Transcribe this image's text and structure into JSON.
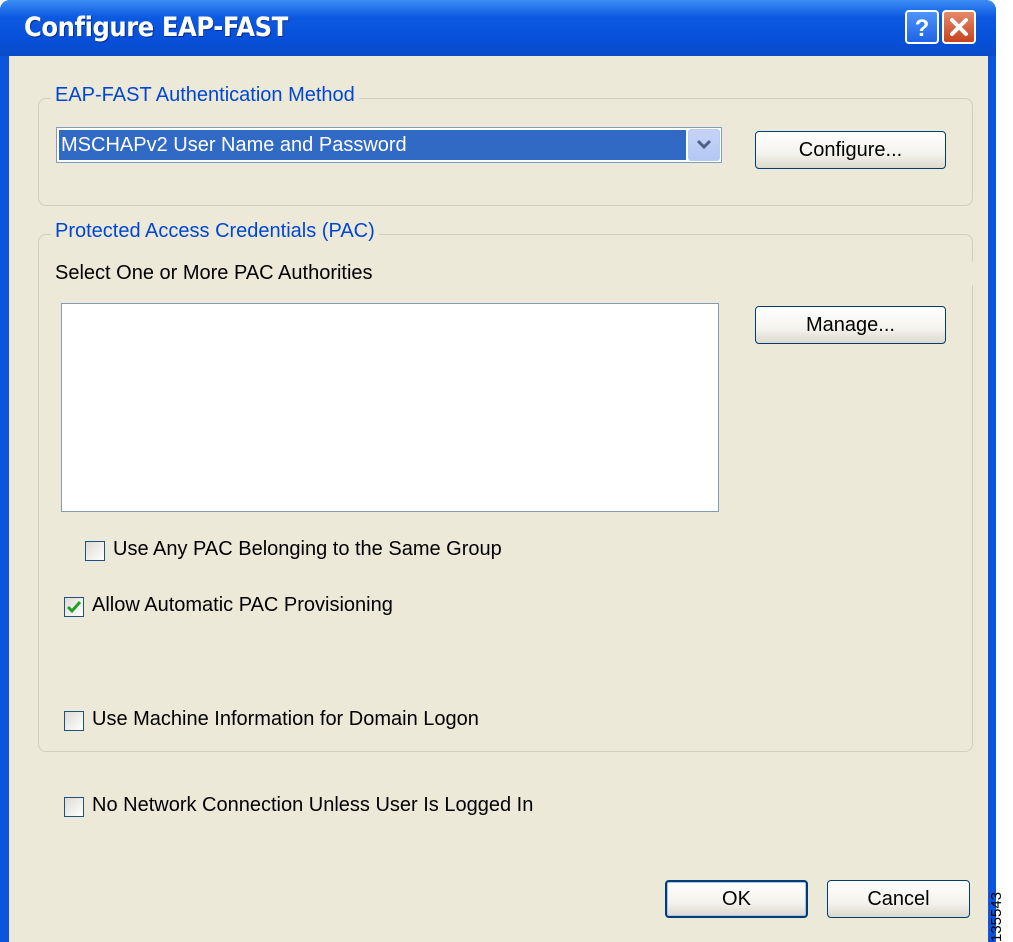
{
  "window": {
    "title": "Configure EAP-FAST"
  },
  "titlebar": {
    "help_icon": "question-mark-icon",
    "close_icon": "close-x-icon"
  },
  "auth_method": {
    "legend": "EAP-FAST Authentication Method",
    "selected": "MSCHAPv2 User Name and Password",
    "configure_label": "Configure..."
  },
  "pac": {
    "legend": "Protected Access Credentials (PAC)",
    "select_label": "Select One or More PAC Authorities",
    "manage_label": "Manage...",
    "authorities": [],
    "use_any_pac": {
      "label": "Use Any PAC Belonging to the Same Group",
      "checked": false
    },
    "allow_auto": {
      "label": "Allow Automatic PAC Provisioning",
      "checked": true
    },
    "use_machine": {
      "label": "Use Machine Information for Domain Logon",
      "checked": false
    }
  },
  "no_network": {
    "label": "No Network Connection Unless User Is Logged In",
    "checked": false
  },
  "footer": {
    "ok_label": "OK",
    "cancel_label": "Cancel"
  },
  "figure_id": "135543",
  "colors": {
    "titlebar": "#0a54e0",
    "dialog_bg": "#ece9d8",
    "legend_text": "#0046d5",
    "selection": "#316ac5",
    "check": "#21a121"
  }
}
